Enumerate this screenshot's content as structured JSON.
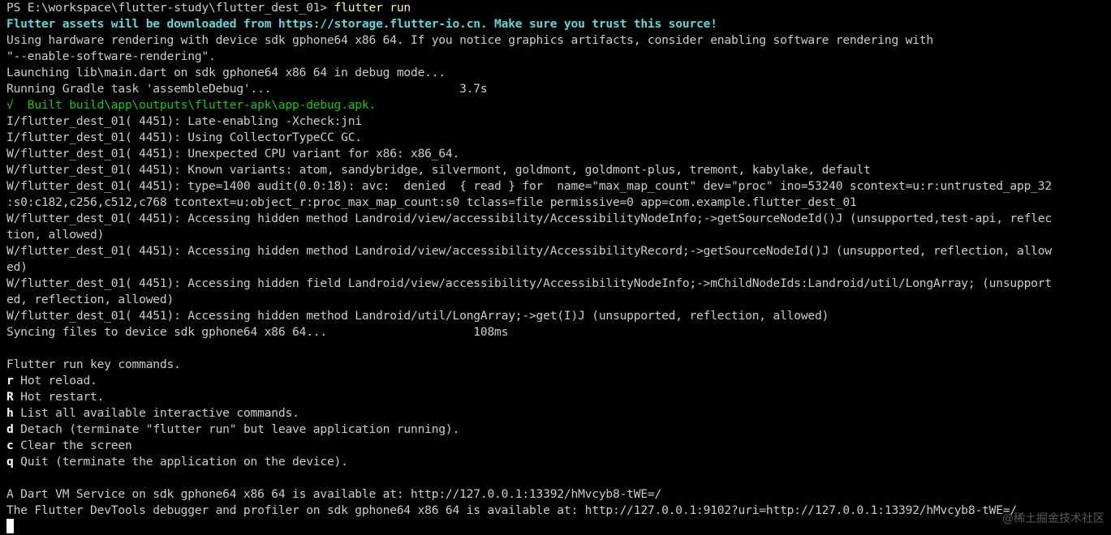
{
  "prompt": {
    "path": "PS E:\\workspace\\flutter-study\\flutter_dest_01> ",
    "command": "flutter run"
  },
  "header_lines": [
    "Flutter assets will be downloaded from https://storage.flutter-io.cn. Make sure you trust this source!"
  ],
  "log_lines_a": [
    "Using hardware rendering with device sdk gphone64 x86 64. If you notice graphics artifacts, consider enabling software rendering with",
    "\"--enable-software-rendering\".",
    "Launching lib\\main.dart on sdk gphone64 x86 64 in debug mode...",
    "Running Gradle task 'assembleDebug'...                           3.7s"
  ],
  "build_line": "√  Built build\\app\\outputs\\flutter-apk\\app-debug.apk.",
  "log_lines_b": [
    "I/flutter_dest_01( 4451): Late-enabling -Xcheck:jni",
    "I/flutter_dest_01( 4451): Using CollectorTypeCC GC.",
    "W/flutter_dest_01( 4451): Unexpected CPU variant for x86: x86_64.",
    "W/flutter_dest_01( 4451): Known variants: atom, sandybridge, silvermont, goldmont, goldmont-plus, tremont, kabylake, default",
    "W/flutter_dest_01( 4451): type=1400 audit(0.0:18): avc:  denied  { read } for  name=\"max_map_count\" dev=\"proc\" ino=53240 scontext=u:r:untrusted_app_32",
    ":s0:c182,c256,c512,c768 tcontext=u:object_r:proc_max_map_count:s0 tclass=file permissive=0 app=com.example.flutter_dest_01",
    "W/flutter_dest_01( 4451): Accessing hidden method Landroid/view/accessibility/AccessibilityNodeInfo;->getSourceNodeId()J (unsupported,test-api, reflec",
    "tion, allowed)",
    "W/flutter_dest_01( 4451): Accessing hidden method Landroid/view/accessibility/AccessibilityRecord;->getSourceNodeId()J (unsupported, reflection, allow",
    "ed)",
    "W/flutter_dest_01( 4451): Accessing hidden field Landroid/view/accessibility/AccessibilityNodeInfo;->mChildNodeIds:Landroid/util/LongArray; (unsupport",
    "ed, reflection, allowed)",
    "W/flutter_dest_01( 4451): Accessing hidden method Landroid/util/LongArray;->get(I)J (unsupported, reflection, allowed)",
    "Syncing files to device sdk gphone64 x86 64...                     108ms",
    "",
    "Flutter run key commands."
  ],
  "key_commands": [
    {
      "key": "r",
      "desc": " Hot reload."
    },
    {
      "key": "R",
      "desc": " Hot restart."
    },
    {
      "key": "h",
      "desc": " List all available interactive commands."
    },
    {
      "key": "d",
      "desc": " Detach (terminate \"flutter run\" but leave application running)."
    },
    {
      "key": "c",
      "desc": " Clear the screen"
    },
    {
      "key": "q",
      "desc": " Quit (terminate the application on the device)."
    }
  ],
  "footer_lines": [
    "",
    "A Dart VM Service on sdk gphone64 x86 64 is available at: http://127.0.0.1:13392/hMvcyb8-tWE=/",
    "The Flutter DevTools debugger and profiler on sdk gphone64 x86 64 is available at: http://127.0.0.1:9102?uri=http://127.0.0.1:13392/hMvcyb8-tWE=/"
  ],
  "watermark": "@稀土掘金技术社区"
}
